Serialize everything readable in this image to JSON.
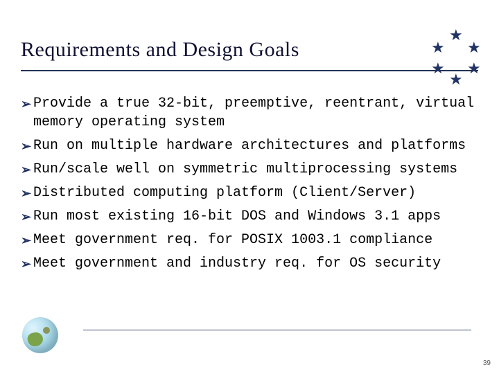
{
  "title": "Requirements and Design Goals",
  "bullets": [
    "Provide a true 32-bit, preemptive, reentrant, virtual memory operating system",
    "Run on multiple hardware architectures and platforms",
    "Run/scale well on symmetric multiprocessing systems",
    "Distributed computing platform (Client/Server)",
    "Run most existing 16-bit DOS and Windows 3.1 apps",
    "Meet government req. for POSIX 1003.1 compliance",
    "Meet government and industry req. for OS security"
  ],
  "page_number": "39",
  "bullet_glyph": "➢"
}
